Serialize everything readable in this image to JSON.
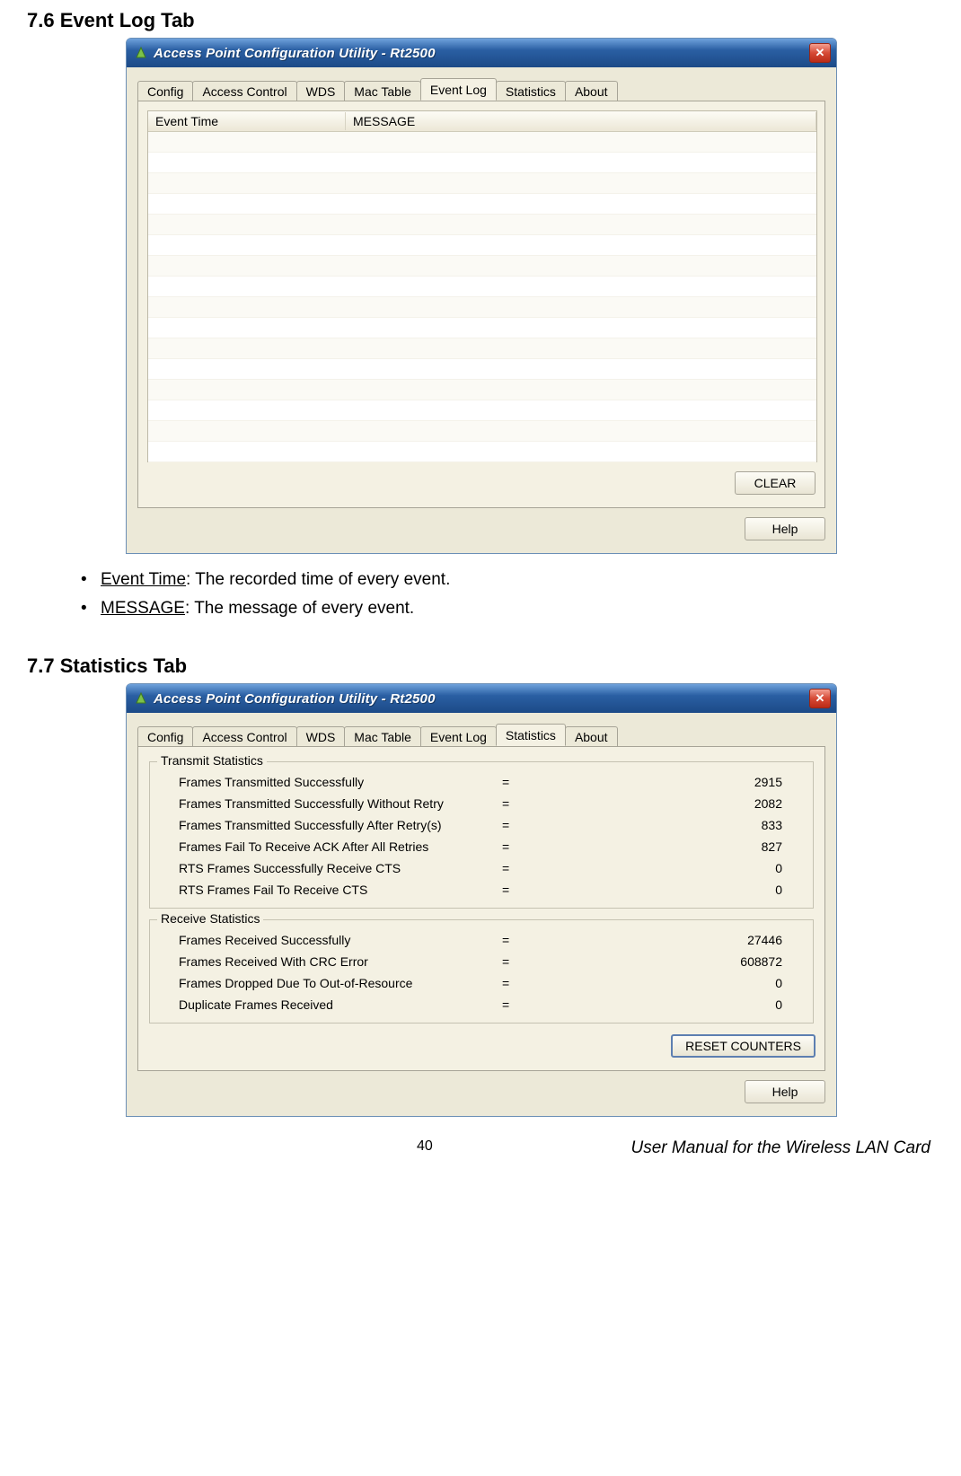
{
  "sections": {
    "s76_title": "7.6 Event Log Tab",
    "s77_title": "7.7 Statistics Tab"
  },
  "window": {
    "title": "Access Point Configuration Utility - Rt2500",
    "tabs": [
      "Config",
      "Access Control",
      "WDS",
      "Mac Table",
      "Event Log",
      "Statistics",
      "About"
    ]
  },
  "event_log": {
    "active_tab": "Event Log",
    "columns": [
      "Event Time",
      "MESSAGE"
    ],
    "clear_label": "CLEAR",
    "help_label": "Help"
  },
  "bullets": {
    "b1_term": "Event Time",
    "b1_desc": ": The recorded time of every event.",
    "b2_term": "MESSAGE",
    "b2_desc": ": The message of every event."
  },
  "statistics": {
    "active_tab": "Statistics",
    "tx_title": "Transmit Statistics",
    "rx_title": "Receive Statistics",
    "tx": [
      {
        "label": "Frames Transmitted Successfully",
        "value": "2915"
      },
      {
        "label": "Frames Transmitted Successfully  Without Retry",
        "value": "2082"
      },
      {
        "label": "Frames Transmitted Successfully After Retry(s)",
        "value": "833"
      },
      {
        "label": "Frames Fail To Receive ACK After All Retries",
        "value": "827"
      },
      {
        "label": "RTS Frames Successfully Receive CTS",
        "value": "0"
      },
      {
        "label": "RTS Frames Fail To Receive CTS",
        "value": "0"
      }
    ],
    "rx": [
      {
        "label": "Frames Received Successfully",
        "value": "27446"
      },
      {
        "label": "Frames Received With CRC Error",
        "value": "608872"
      },
      {
        "label": "Frames Dropped Due To Out-of-Resource",
        "value": "0"
      },
      {
        "label": "Duplicate Frames Received",
        "value": "0"
      }
    ],
    "reset_label": "RESET COUNTERS",
    "help_label": "Help"
  },
  "footer": {
    "page": "40",
    "text": "User Manual for the Wireless LAN Card"
  }
}
